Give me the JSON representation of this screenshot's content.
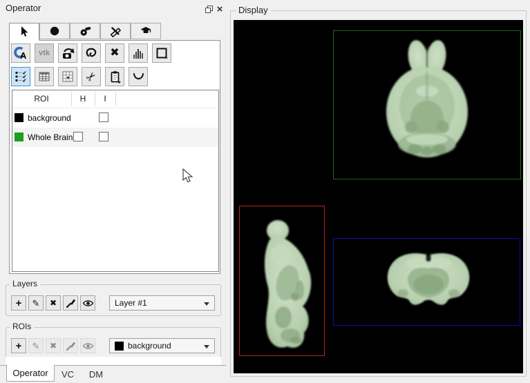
{
  "icons": {
    "atlas_letter": "A",
    "delete_glyph": "✖",
    "scissors_glyph": "✂",
    "pencil_glyph": "✎",
    "plus_glyph": "+",
    "close_glyph": "×"
  },
  "operator_panel": {
    "title": "Operator",
    "tool_tabs": [
      "pointer",
      "sphere",
      "whistle",
      "utilities",
      "education"
    ],
    "toolbar": {
      "vtk_label": "vtk",
      "row1": [
        "atlas",
        "vtk-export",
        "snapshot",
        "lasso",
        "delete-roi",
        "histogram",
        "rectangle-select"
      ],
      "row2": [
        "roi-checklist",
        "table",
        "table-export",
        "cut",
        "paste",
        "curve"
      ],
      "active_tool": "roi-checklist"
    },
    "roi_table": {
      "columns": [
        "ROI",
        "H",
        "I"
      ],
      "rows": [
        {
          "label": "background",
          "swatch_color": "#000000",
          "h_checkbox": "none",
          "i_checkbox": "unchecked"
        },
        {
          "label": "Whole Brain",
          "swatch_color": "#1f9e1f",
          "h_checkbox": "unchecked",
          "i_checkbox": "unchecked"
        }
      ]
    },
    "layers_group": {
      "title": "Layers",
      "selected_layer": "Layer #1"
    },
    "rois_group": {
      "title": "ROIs",
      "selected_roi": "background",
      "selected_roi_color": "#000000"
    }
  },
  "bottom_tabs": {
    "labels": [
      "Operator",
      "VC",
      "DM"
    ],
    "selected": "Operator"
  },
  "display_panel": {
    "title": "Display",
    "background": "#000000",
    "brain_tint": "#bed6b5",
    "views": [
      {
        "name": "axial-view",
        "frame_color": "#1a6b1a"
      },
      {
        "name": "sagittal-view",
        "frame_color": "#bf2020"
      },
      {
        "name": "coronal-view",
        "frame_color": "#0e0ea8"
      }
    ]
  }
}
